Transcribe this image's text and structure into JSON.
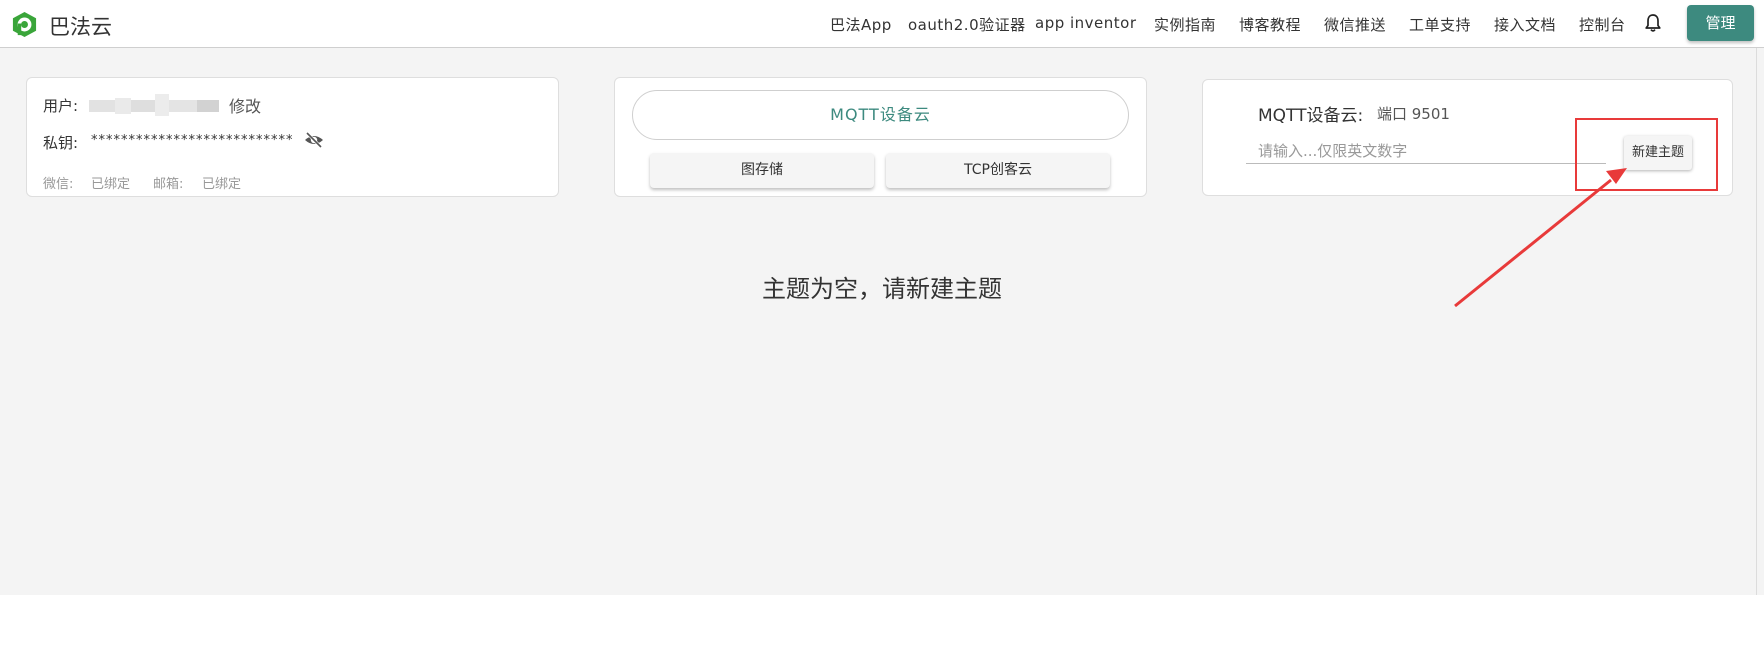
{
  "header": {
    "brand": "巴法云",
    "nav": [
      "巴法App",
      "oauth2.0验证器",
      "app inventor",
      "实例指南",
      "博客教程",
      "微信推送",
      "工单支持",
      "接入文档",
      "控制台"
    ],
    "manage_label": "管理"
  },
  "user_card": {
    "user_label": "用户:",
    "edit_label": "修改",
    "key_label": "私钥:",
    "key_masked": "***************************",
    "wechat_label": "微信:",
    "wechat_status": "已绑定",
    "email_label": "邮箱:",
    "email_status": "已绑定"
  },
  "service_card": {
    "main_label": "MQTT设备云",
    "image_storage_label": "图存储",
    "tcp_label": "TCP创客云"
  },
  "topic_card": {
    "title": "MQTT设备云:",
    "port": "端口 9501",
    "input_placeholder": "请输入...仅限英文数字",
    "input_value": "",
    "new_topic_label": "新建主题"
  },
  "empty_message": "主题为空，请新建主题",
  "colors": {
    "accent": "#3d8a7f",
    "annotation": "#e83a3a"
  }
}
